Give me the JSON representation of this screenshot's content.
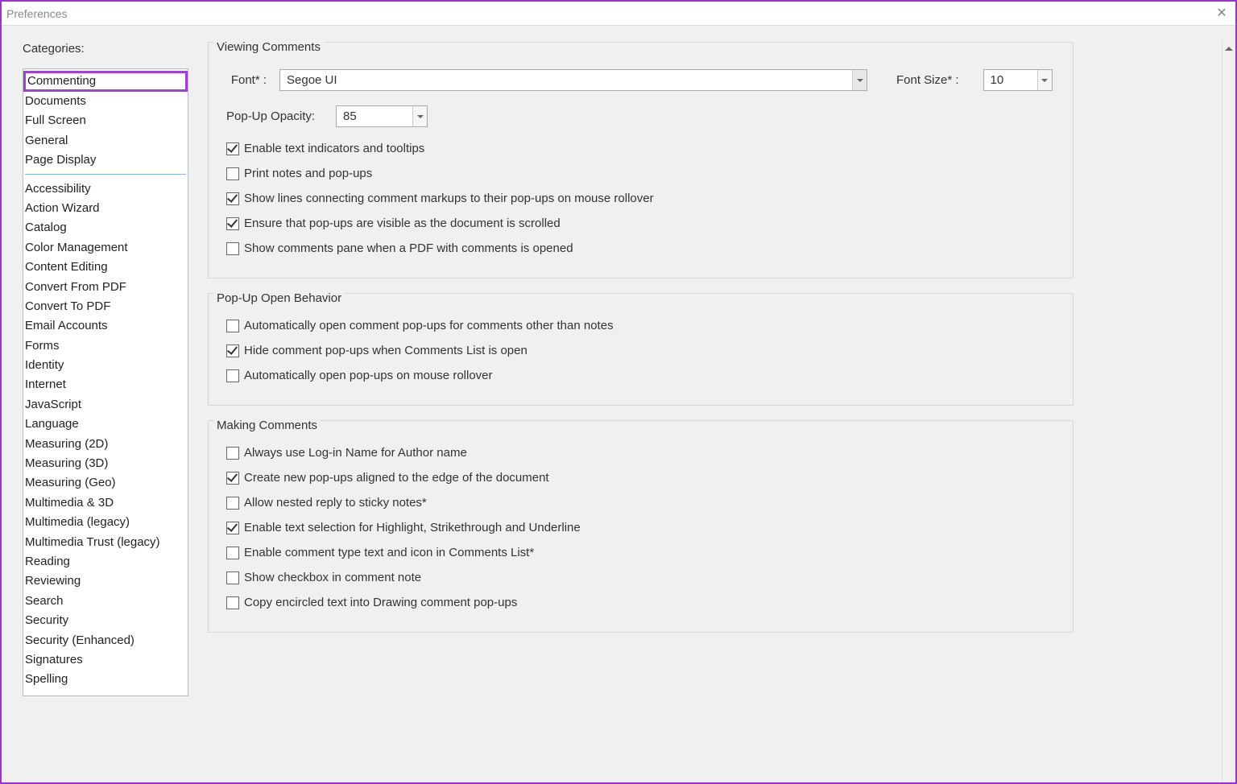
{
  "window": {
    "title": "Preferences"
  },
  "sidebar": {
    "header": "Categories:",
    "primary": [
      "Commenting",
      "Documents",
      "Full Screen",
      "General",
      "Page Display"
    ],
    "secondary": [
      "Accessibility",
      "Action Wizard",
      "Catalog",
      "Color Management",
      "Content Editing",
      "Convert From PDF",
      "Convert To PDF",
      "Email Accounts",
      "Forms",
      "Identity",
      "Internet",
      "JavaScript",
      "Language",
      "Measuring (2D)",
      "Measuring (3D)",
      "Measuring (Geo)",
      "Multimedia & 3D",
      "Multimedia (legacy)",
      "Multimedia Trust (legacy)",
      "Reading",
      "Reviewing",
      "Search",
      "Security",
      "Security (Enhanced)",
      "Signatures",
      "Spelling"
    ],
    "selected": "Commenting"
  },
  "sections": {
    "viewing": {
      "legend": "Viewing Comments",
      "font_label": "Font* :",
      "font_value": "Segoe UI",
      "fontsize_label": "Font Size* :",
      "fontsize_value": "10",
      "opacity_label": "Pop-Up Opacity:",
      "opacity_value": "85",
      "checks": [
        {
          "label": "Enable text indicators and tooltips",
          "checked": true
        },
        {
          "label": "Print notes and pop-ups",
          "checked": false
        },
        {
          "label": "Show lines connecting comment markups to their pop-ups on mouse rollover",
          "checked": true
        },
        {
          "label": "Ensure that pop-ups are visible as the document is scrolled",
          "checked": true
        },
        {
          "label": "Show comments pane when a PDF with comments is opened",
          "checked": false
        }
      ]
    },
    "popup": {
      "legend": "Pop-Up Open Behavior",
      "checks": [
        {
          "label": "Automatically open comment pop-ups for comments other than notes",
          "checked": false
        },
        {
          "label": "Hide comment pop-ups when Comments List is open",
          "checked": true
        },
        {
          "label": "Automatically open pop-ups on mouse rollover",
          "checked": false
        }
      ]
    },
    "making": {
      "legend": "Making Comments",
      "checks": [
        {
          "label": "Always use Log-in Name for Author name",
          "checked": false
        },
        {
          "label": "Create new pop-ups aligned to the edge of the document",
          "checked": true
        },
        {
          "label": "Allow nested reply to sticky notes*",
          "checked": false
        },
        {
          "label": "Enable text selection for Highlight, Strikethrough and Underline",
          "checked": true
        },
        {
          "label": "Enable comment type text and icon in Comments List*",
          "checked": false
        },
        {
          "label": "Show checkbox in comment note",
          "checked": false
        },
        {
          "label": "Copy encircled text into Drawing comment pop-ups",
          "checked": false
        }
      ]
    }
  }
}
